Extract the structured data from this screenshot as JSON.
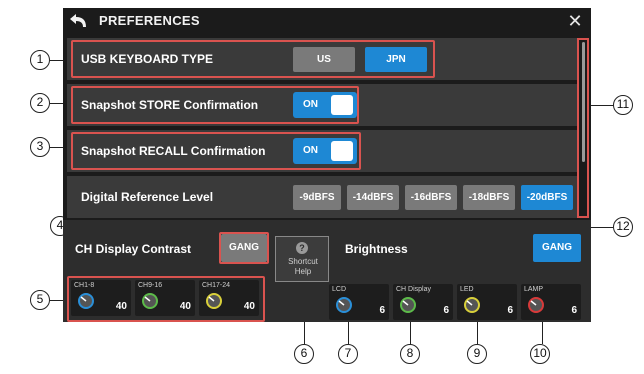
{
  "window": {
    "title": "PREFERENCES"
  },
  "rows": {
    "usb_keyboard": {
      "label": "USB KEYBOARD TYPE",
      "options": [
        "US",
        "JPN"
      ],
      "selected": "JPN"
    },
    "snapshot_store": {
      "label": "Snapshot STORE Confirmation",
      "toggle": "ON"
    },
    "snapshot_recall": {
      "label": "Snapshot RECALL Confirmation",
      "toggle": "ON"
    },
    "digital_ref": {
      "label": "Digital Reference Level",
      "options": [
        "-9dBFS",
        "-14dBFS",
        "-16dBFS",
        "-18dBFS",
        "-20dBFS"
      ],
      "selected": "-20dBFS"
    }
  },
  "ch_display": {
    "title": "CH Display Contrast",
    "gang_label": "GANG",
    "knobs": [
      {
        "name": "CH1-8",
        "value": "40",
        "color": "#2a8fd8"
      },
      {
        "name": "CH9-16",
        "value": "40",
        "color": "#5dbb4a"
      },
      {
        "name": "CH17-24",
        "value": "40",
        "color": "#d8cf3a"
      }
    ]
  },
  "shortcut": {
    "line1": "Shortcut",
    "line2": "Help"
  },
  "brightness": {
    "title": "Brightness",
    "gang_label": "GANG",
    "knobs": [
      {
        "name": "LCD",
        "value": "6",
        "color": "#2a8fd8"
      },
      {
        "name": "CH Display",
        "value": "6",
        "color": "#5dbb4a"
      },
      {
        "name": "LED",
        "value": "6",
        "color": "#d8cf3a"
      },
      {
        "name": "LAMP",
        "value": "6",
        "color": "#d83a3a"
      }
    ]
  },
  "callouts": [
    "1",
    "2",
    "3",
    "4",
    "5",
    "6",
    "7",
    "8",
    "9",
    "10",
    "11",
    "12"
  ]
}
